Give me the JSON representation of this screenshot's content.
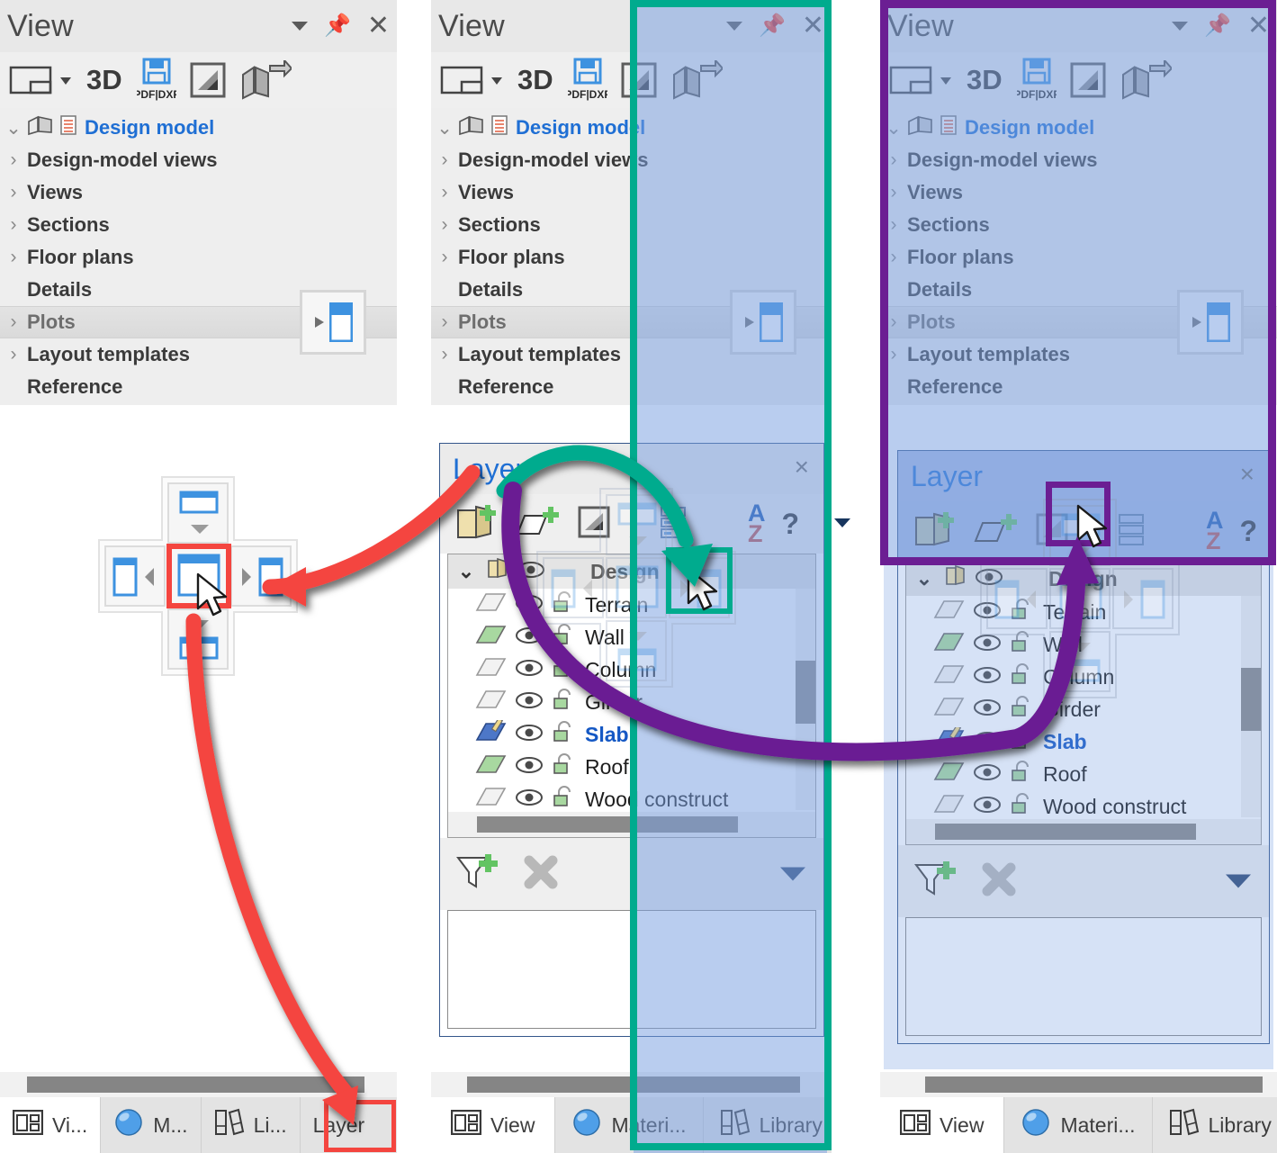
{
  "panels": [
    {
      "id": "panel-left",
      "title": "View",
      "titlebar_icons": [
        "caret-down-icon",
        "pin-icon",
        "close-icon"
      ],
      "toolbar_items": [
        "layout-icon",
        "dropdown-caret",
        "3D",
        "PDF|DXF",
        "contrast-icon",
        "model-back-icon"
      ],
      "toolbar_3d_label": "3D",
      "toolbar_pdf_label": "PDF|DXF",
      "tree": [
        {
          "label": "Design model",
          "chev": "v",
          "root": true
        },
        {
          "label": "Design-model views",
          "chev": ">"
        },
        {
          "label": "Views",
          "chev": ">"
        },
        {
          "label": "Sections",
          "chev": ">"
        },
        {
          "label": "Floor plans",
          "chev": ">"
        },
        {
          "label": "Details",
          "chev": ""
        },
        {
          "label": "Plots",
          "chev": ">",
          "highlight": true
        },
        {
          "label": "Layout templates",
          "chev": ">"
        },
        {
          "label": "Reference",
          "chev": ""
        }
      ],
      "tabs": [
        {
          "label": "Vi...",
          "icon": "view-layout-icon",
          "active": true
        },
        {
          "label": "M...",
          "icon": "material-sphere-icon",
          "active": false
        },
        {
          "label": "Li...",
          "icon": "library-books-icon",
          "active": false
        },
        {
          "label": "Layer",
          "icon": "",
          "active": false
        }
      ]
    },
    {
      "id": "panel-middle",
      "title": "View",
      "titlebar_icons": [
        "caret-down-icon",
        "pin-icon",
        "close-icon"
      ],
      "toolbar_3d_label": "3D",
      "toolbar_pdf_label": "PDF|DXF",
      "tree": [
        {
          "label": "Design model",
          "chev": "v",
          "root": true
        },
        {
          "label": "Design-model views",
          "chev": ">"
        },
        {
          "label": "Views",
          "chev": ">"
        },
        {
          "label": "Sections",
          "chev": ">"
        },
        {
          "label": "Floor plans",
          "chev": ">"
        },
        {
          "label": "Details",
          "chev": ""
        },
        {
          "label": "Plots",
          "chev": ">",
          "highlight": true
        },
        {
          "label": "Layout templates",
          "chev": ">"
        },
        {
          "label": "Reference",
          "chev": ""
        }
      ],
      "tabs": [
        {
          "label": "View",
          "icon": "view-layout-icon",
          "active": true
        },
        {
          "label": "Materi...",
          "icon": "material-sphere-icon",
          "active": false
        },
        {
          "label": "Library",
          "icon": "library-books-icon",
          "active": false
        }
      ]
    },
    {
      "id": "panel-right",
      "title": "View",
      "titlebar_icons": [
        "caret-down-icon",
        "pin-icon",
        "close-icon"
      ],
      "toolbar_3d_label": "3D",
      "toolbar_pdf_label": "PDF|DXF",
      "tree": [
        {
          "label": "Design model",
          "chev": "v",
          "root": true
        },
        {
          "label": "Design-model views",
          "chev": ">"
        },
        {
          "label": "Views",
          "chev": ">"
        },
        {
          "label": "Sections",
          "chev": ">"
        },
        {
          "label": "Floor plans",
          "chev": ">"
        },
        {
          "label": "Details",
          "chev": ""
        },
        {
          "label": "Plots",
          "chev": ">",
          "highlight": true
        },
        {
          "label": "Layout templates",
          "chev": ">"
        },
        {
          "label": "Reference",
          "chev": ""
        }
      ],
      "tabs": [
        {
          "label": "View",
          "icon": "view-layout-icon",
          "active": true
        },
        {
          "label": "Materi...",
          "icon": "material-sphere-icon",
          "active": false
        },
        {
          "label": "Library",
          "icon": "library-books-icon",
          "active": false
        }
      ]
    }
  ],
  "layer_window": {
    "title": "Layer",
    "close_label": "×",
    "toolbar_items": [
      "new-folder-icon",
      "new-layer-icon",
      "contrast-icon",
      "list-view-icon",
      "sort-az-icon",
      "help-icon",
      "dropdown-caret-icon"
    ],
    "sort_a": "A",
    "sort_z": "Z",
    "help": "?",
    "group_row": {
      "label": "Design",
      "chev": "v",
      "icon": "folder-icon",
      "eye": "eye-icon"
    },
    "rows": [
      {
        "name": "Terrain",
        "visible": true,
        "locked": false,
        "selected": false,
        "swatch": "#f2f2f2"
      },
      {
        "name": "Wall",
        "visible": true,
        "locked": false,
        "selected": false,
        "swatch": "#a8d8a0"
      },
      {
        "name": "Column",
        "visible": true,
        "locked": false,
        "selected": false,
        "swatch": "#f2f2f2"
      },
      {
        "name": "Girder",
        "visible": true,
        "locked": false,
        "selected": false,
        "swatch": "#f2f2f2"
      },
      {
        "name": "Slab",
        "visible": true,
        "locked": false,
        "selected": true,
        "swatch": "#4d77c8"
      },
      {
        "name": "Roof",
        "visible": true,
        "locked": false,
        "selected": false,
        "swatch": "#a8d8a0"
      },
      {
        "name": "Wood construct",
        "visible": true,
        "locked": false,
        "selected": false,
        "swatch": "#f2f2f2"
      }
    ],
    "filter_icons": [
      "add-filter-icon",
      "delete-filter-icon",
      "caret-down-icon"
    ]
  },
  "annotations": {
    "red": {
      "color": "#f4453f",
      "target_label": "Layer",
      "meaning": "drag Layer tab to center dock target"
    },
    "green": {
      "color": "#00ab8e",
      "meaning": "dock right - side by side"
    },
    "purple": {
      "color": "#6b1e93",
      "meaning": "dock top - stacked"
    }
  },
  "dock_widget": {
    "targets": [
      "dock-top",
      "dock-left",
      "dock-center",
      "dock-right",
      "dock-bottom"
    ],
    "selected": "dock-center"
  },
  "colors": {
    "accent_blue": "#1f6fd4",
    "panel_bg": "#eeeeee",
    "titlebar_bg": "#e8e8e8",
    "highlight_red": "#f4453f",
    "highlight_green": "#00ab8e",
    "highlight_purple": "#6b1e93",
    "drag_tint": "#9db4de",
    "icon_blue": "#3d92e0"
  }
}
